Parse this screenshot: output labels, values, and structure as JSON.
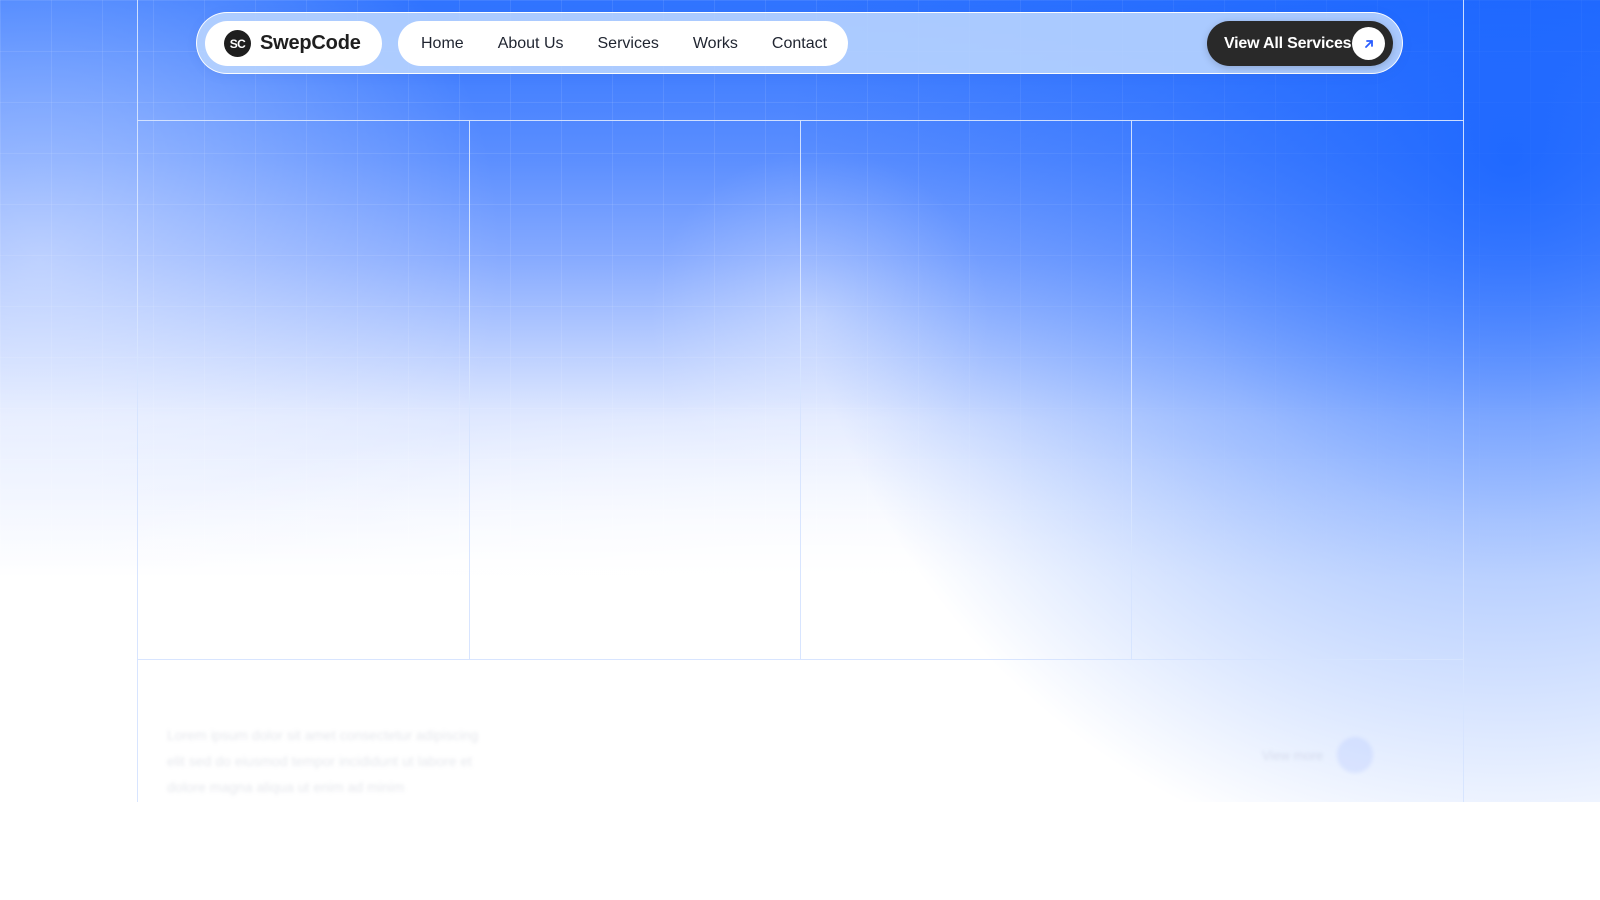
{
  "brand": {
    "logo_text": "SC",
    "name": "SwepCode"
  },
  "nav": {
    "items": [
      {
        "label": "Home"
      },
      {
        "label": "About Us"
      },
      {
        "label": "Services"
      },
      {
        "label": "Works"
      },
      {
        "label": "Contact"
      }
    ]
  },
  "cta": {
    "label": "View All Services",
    "icon": "arrow-up-right-icon"
  },
  "colors": {
    "primary_blue": "#2f73ff",
    "navbar_tint": "#b8d4ff",
    "dark_button": "#292929",
    "line": "#d6e4ff"
  }
}
